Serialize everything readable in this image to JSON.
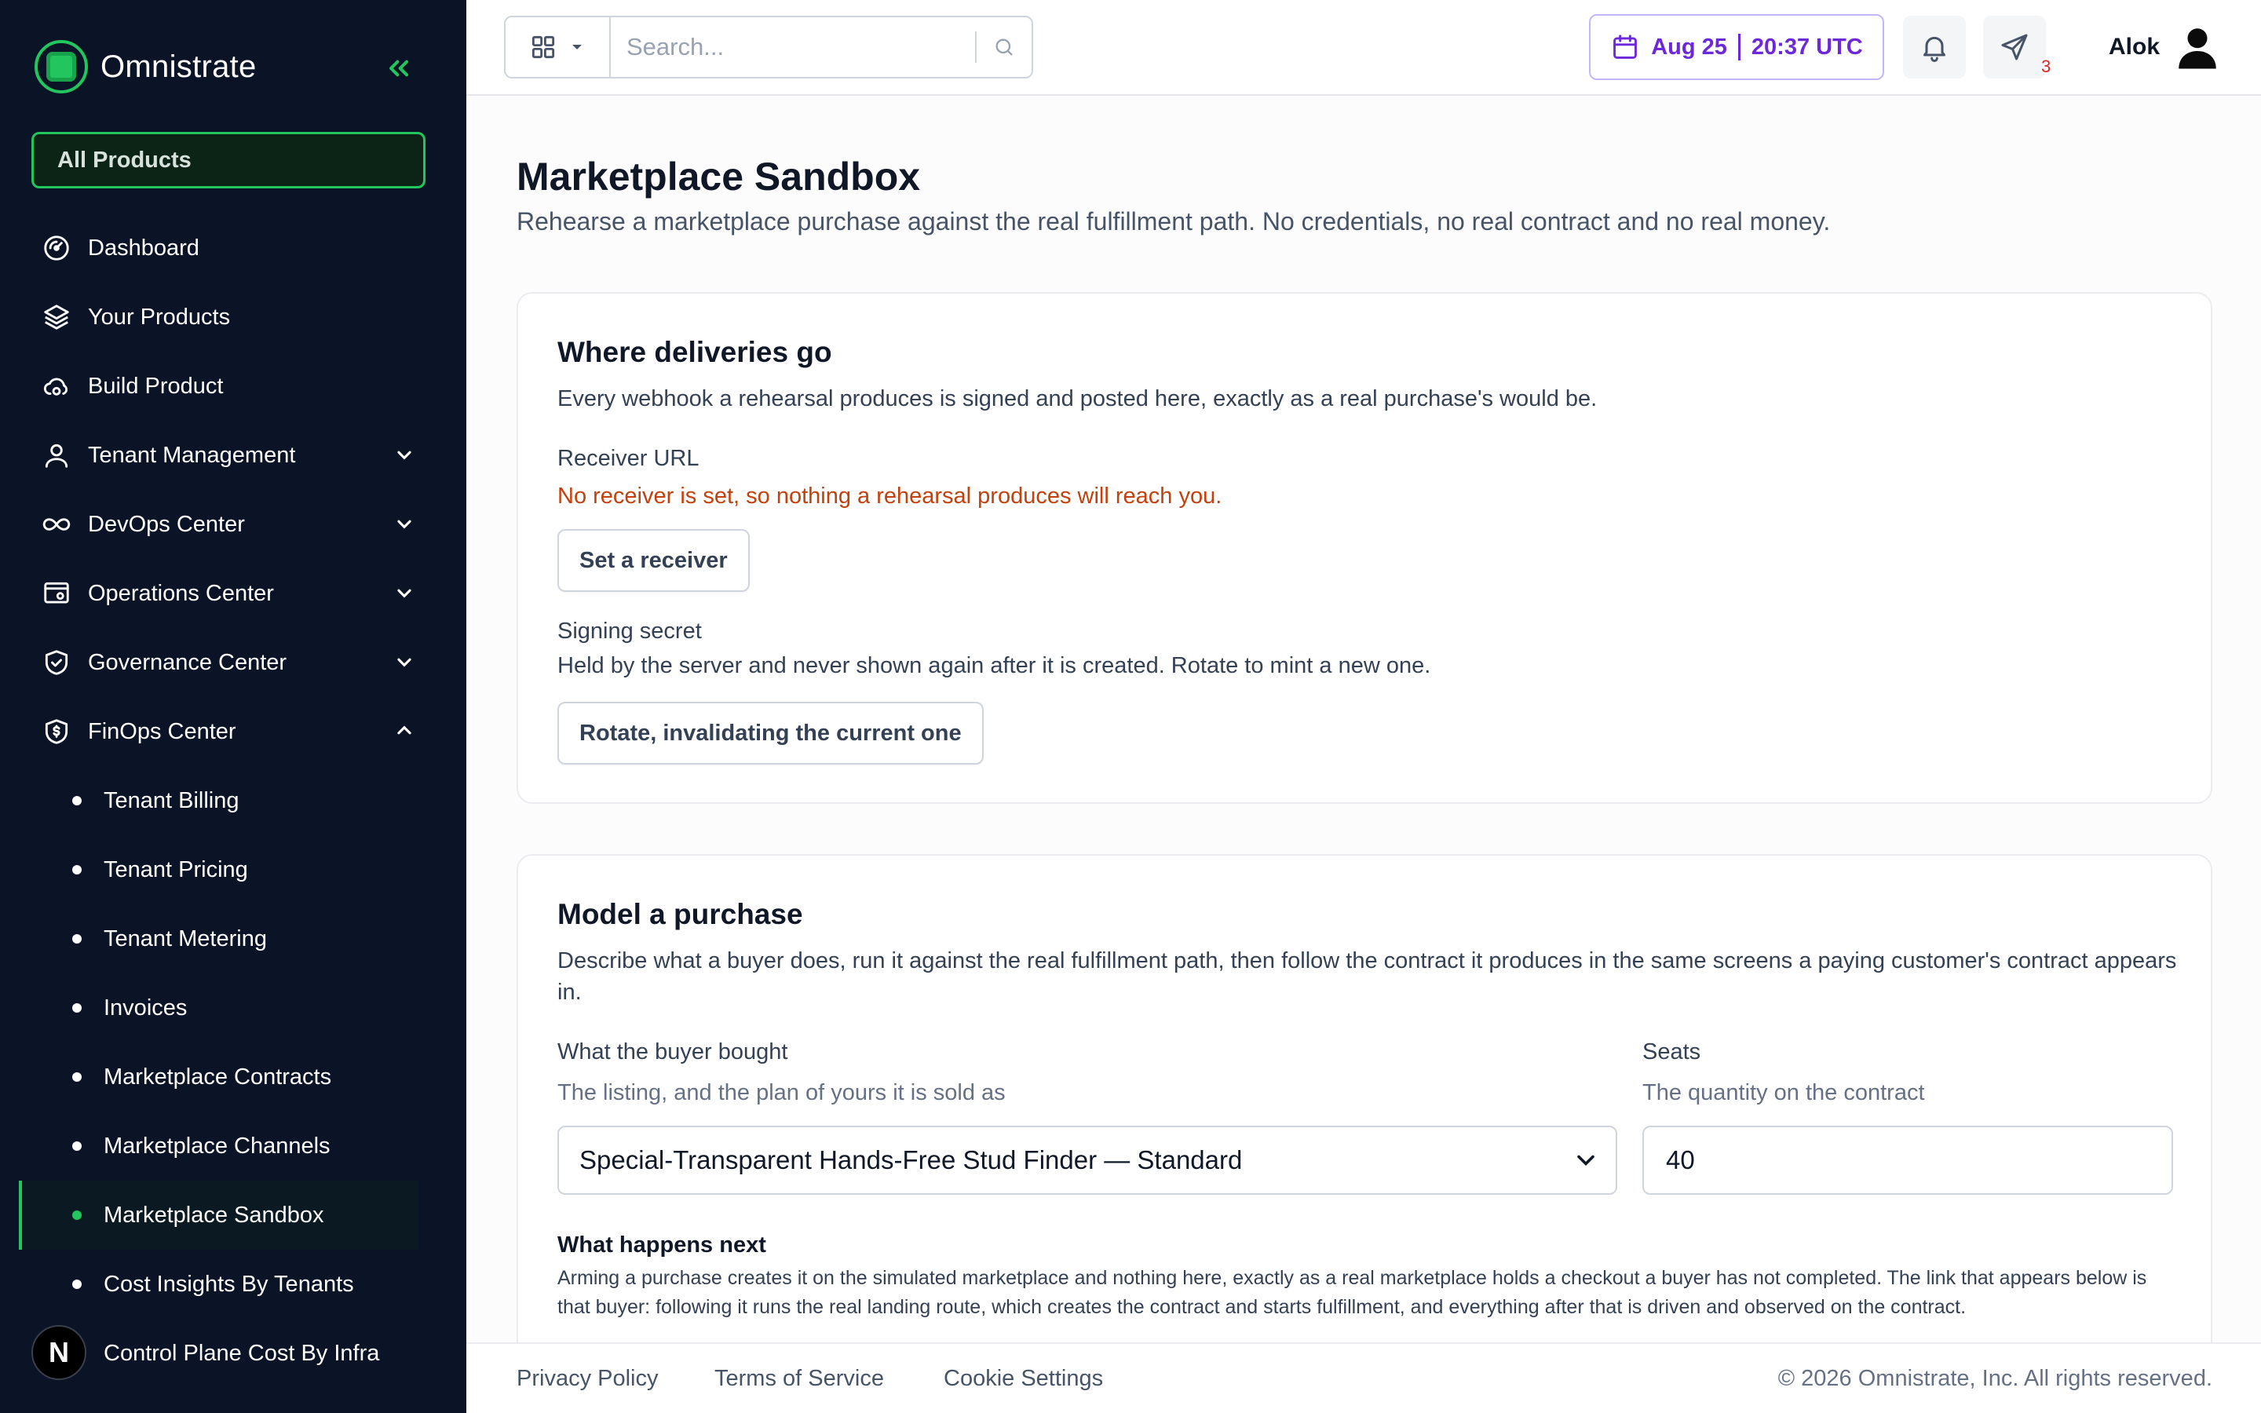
{
  "brand": {
    "name": "Omnistrate"
  },
  "sidebar": {
    "all_products": "All Products",
    "items": [
      {
        "label": "Dashboard",
        "icon": "dashboard-icon",
        "expandable": false
      },
      {
        "label": "Your Products",
        "icon": "layers-icon",
        "expandable": false
      },
      {
        "label": "Build Product",
        "icon": "cloud-build-icon",
        "expandable": false
      },
      {
        "label": "Tenant Management",
        "icon": "user-icon",
        "expandable": true,
        "expanded": false
      },
      {
        "label": "DevOps Center",
        "icon": "infinity-icon",
        "expandable": true,
        "expanded": false
      },
      {
        "label": "Operations Center",
        "icon": "settings-window-icon",
        "expandable": true,
        "expanded": false
      },
      {
        "label": "Governance Center",
        "icon": "shield-check-icon",
        "expandable": true,
        "expanded": false
      },
      {
        "label": "FinOps Center",
        "icon": "shield-dollar-icon",
        "expandable": true,
        "expanded": true
      }
    ],
    "finops_items": [
      "Tenant Billing",
      "Tenant Pricing",
      "Tenant Metering",
      "Invoices",
      "Marketplace Contracts",
      "Marketplace Channels",
      "Marketplace Sandbox",
      "Cost Insights By Tenants",
      "Control Plane Cost By Infra"
    ],
    "active_item": "Marketplace Sandbox",
    "avatar_letter": "N",
    "accent_color": "#22c55e",
    "background_color": "#0b1426"
  },
  "topbar": {
    "search_placeholder": "Search...",
    "date": "Aug 25",
    "time": "20:37 UTC",
    "notification_badge": "3",
    "user_name": "Alok",
    "date_color": "#6d28d9"
  },
  "page": {
    "title": "Marketplace Sandbox",
    "subtitle": "Rehearse a marketplace purchase against the real fulfillment path. No credentials, no real contract and no real money."
  },
  "deliveries": {
    "title": "Where deliveries go",
    "description": "Every webhook a rehearsal produces is signed and posted here, exactly as a real purchase's would be.",
    "receiver_label": "Receiver URL",
    "receiver_warning": "No receiver is set, so nothing a rehearsal produces will reach you.",
    "set_receiver_button": "Set a receiver",
    "secret_label": "Signing secret",
    "secret_description": "Held by the server and never shown again after it is created. Rotate to mint a new one.",
    "rotate_button": "Rotate, invalidating the current one",
    "warning_color": "#c2410c"
  },
  "purchase": {
    "title": "Model a purchase",
    "description": "Describe what a buyer does, run it against the real fulfillment path, then follow the contract it produces in the same screens a paying customer's contract appears in.",
    "bought_label": "What the buyer bought",
    "bought_hint": "The listing, and the plan of yours it is sold as",
    "bought_value": "Special-Transparent Hands-Free Stud Finder — Standard",
    "seats_label": "Seats",
    "seats_hint": "The quantity on the contract",
    "seats_value": "40",
    "next_title": "What happens next",
    "next_description": "Arming a purchase creates it on the simulated marketplace and nothing here, exactly as a real marketplace holds a checkout a buyer has not completed. The link that appears below is that buyer: following it runs the real landing route, which creates the contract and starts fulfillment, and everything after that is driven and observed on the contract."
  },
  "footer": {
    "privacy": "Privacy Policy",
    "terms": "Terms of Service",
    "cookies": "Cookie Settings",
    "copyright": "© 2026 Omnistrate, Inc. All rights reserved."
  }
}
